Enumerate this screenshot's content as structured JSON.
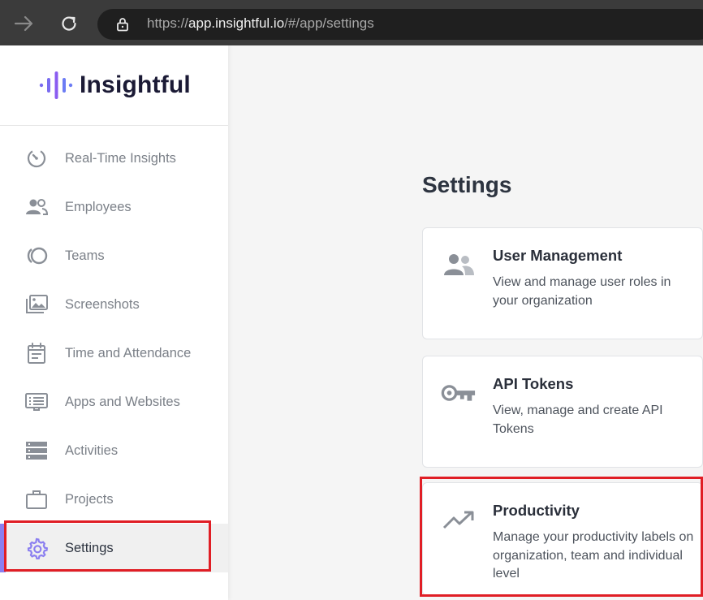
{
  "browser": {
    "url_scheme": "https://",
    "url_host": "app.insightful.io",
    "url_path": "/#/app/settings"
  },
  "app": {
    "brand": "Insightful",
    "brand_color": "#6b5ce7"
  },
  "sidebar": {
    "items": [
      {
        "label": "Real-Time Insights",
        "icon": "speedometer-icon"
      },
      {
        "label": "Employees",
        "icon": "people-icon"
      },
      {
        "label": "Teams",
        "icon": "teams-icon"
      },
      {
        "label": "Screenshots",
        "icon": "images-icon"
      },
      {
        "label": "Time and Attendance",
        "icon": "calendar-icon"
      },
      {
        "label": "Apps and Websites",
        "icon": "monitor-icon"
      },
      {
        "label": "Activities",
        "icon": "list-icon"
      },
      {
        "label": "Projects",
        "icon": "briefcase-icon"
      },
      {
        "label": "Settings",
        "icon": "gear-icon",
        "active": true
      }
    ]
  },
  "main": {
    "title": "Settings",
    "cards": [
      {
        "title": "User Management",
        "description": "View and manage user roles in your organization",
        "icon": "users-icon"
      },
      {
        "title": "API Tokens",
        "description": "View, manage and create API Tokens",
        "icon": "key-icon"
      },
      {
        "title": "Productivity",
        "description": "Manage your productivity labels on organization, team and individual level",
        "icon": "trend-icon"
      }
    ]
  },
  "colors": {
    "highlight": "#e01e25",
    "active_accent": "#8b7ff0"
  }
}
